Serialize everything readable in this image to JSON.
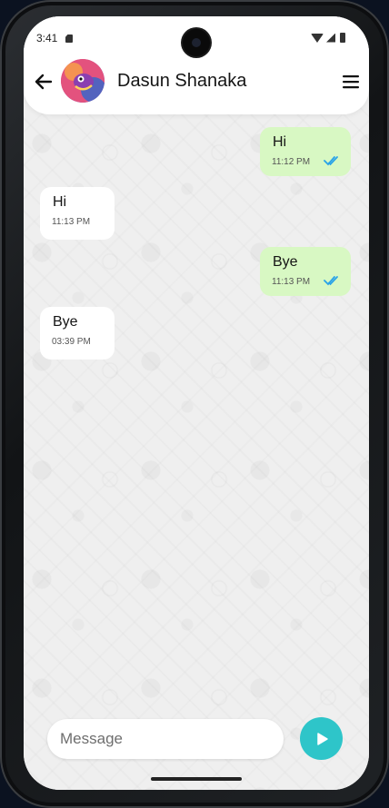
{
  "status_bar": {
    "time": "3:41"
  },
  "header": {
    "contact_name": "Dasun Shanaka",
    "back_icon": "arrow-left-icon",
    "menu_icon": "hamburger-menu-icon"
  },
  "messages": [
    {
      "direction": "outgoing",
      "text": "Hi",
      "time": "11:12 PM",
      "read": true
    },
    {
      "direction": "incoming",
      "text": "Hi",
      "time": "11:13 PM"
    },
    {
      "direction": "outgoing",
      "text": "Bye",
      "time": "11:13 PM",
      "read": true
    },
    {
      "direction": "incoming",
      "text": "Bye",
      "time": "03:39 PM"
    }
  ],
  "composer": {
    "placeholder": "Message",
    "send_icon": "play-send-icon"
  },
  "colors": {
    "outgoing_bubble": "#d8f8c3",
    "incoming_bubble": "#ffffff",
    "send_button": "#2ec5c9",
    "read_ticks": "#2aa3e8"
  }
}
